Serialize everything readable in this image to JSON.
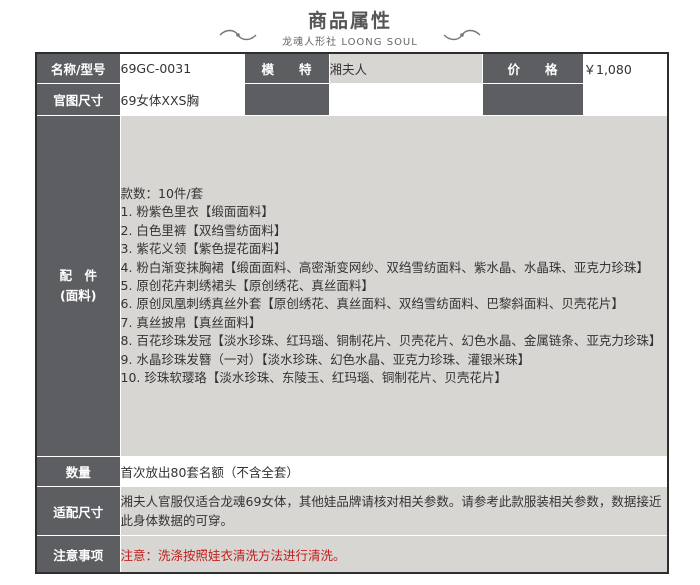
{
  "header": {
    "title": "商品属性",
    "subtitle": "龙魂人形社 LOONG SOUL"
  },
  "row1": {
    "name_label": "名称/型号",
    "name_value": "69GC-0031",
    "model_label": "模　　特",
    "model_value": "湘夫人",
    "price_label": "价　　格",
    "price_value": "￥1,080"
  },
  "row2": {
    "size_label": "官图尺寸",
    "size_value": "69女体XXS胸"
  },
  "parts": {
    "label_line1": "配　件",
    "label_line2": "(面料)",
    "lines": [
      "款数：10件/套",
      "1. 粉紫色里衣【缎面面料】",
      "2. 白色里裤【双绉雪纺面料】",
      "3. 紫花义领【紫色提花面料】",
      "4. 粉白渐变抹胸裙【缎面面料、高密渐变网纱、双绉雪纺面料、紫水晶、水晶珠、亚克力珍珠】",
      "5. 原创花卉刺绣裙头【原创绣花、真丝面料】",
      "6. 原创凤凰刺绣真丝外套【原创绣花、真丝面料、双绉雪纺面料、巴黎斜面料、贝壳花片】",
      "7. 真丝披帛【真丝面料】",
      "8. 百花珍珠发冠【淡水珍珠、红玛瑙、铜制花片、贝壳花片、幻色水晶、金属链条、亚克力珍珠】",
      "9. 水晶珍珠发簪（一对）【淡水珍珠、幻色水晶、亚克力珍珠、灌银米珠】",
      "10. 珍珠软璎珞【淡水珍珠、东陵玉、红玛瑙、铜制花片、贝壳花片】"
    ]
  },
  "quantity": {
    "label": "数量",
    "value": "首次放出80套名额（不含全套）"
  },
  "fit": {
    "label": "适配尺寸",
    "value": "湘夫人官服仅适合龙魂69女体，其他娃品牌请核对相关参数。请参考此款服装相关参数，数据接近此身体数据的可穿。"
  },
  "notice": {
    "label": "注意事项",
    "value": "注意：洗涤按照娃衣清洗方法进行清洗。"
  },
  "colors": {
    "label_bg": "#5d5e62",
    "value_bg": "#d8d6d2",
    "notice_text": "#c21d1d"
  }
}
